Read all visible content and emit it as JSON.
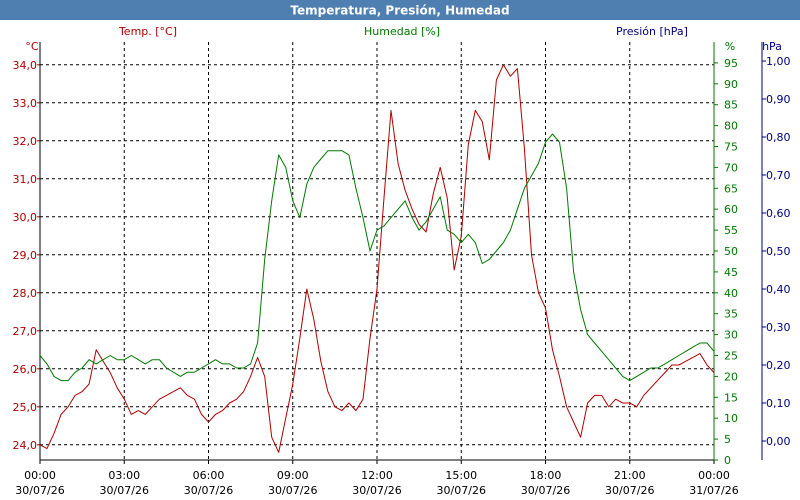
{
  "chart_data": {
    "type": "line",
    "title": "Temperatura, Presión, Humedad",
    "colors": {
      "title_bar": "#4f7fb0",
      "title_text": "#ffffff",
      "temp": "#b00000",
      "humidity": "#007a00",
      "pressure": "#000080",
      "grid": "#000000"
    },
    "grid": true,
    "x_ticks": [
      {
        "time": "00:00",
        "date": "30/07/26"
      },
      {
        "time": "03:00",
        "date": "30/07/26"
      },
      {
        "time": "06:00",
        "date": "30/07/26"
      },
      {
        "time": "09:00",
        "date": "30/07/26"
      },
      {
        "time": "12:00",
        "date": "30/07/26"
      },
      {
        "time": "15:00",
        "date": "30/07/26"
      },
      {
        "time": "18:00",
        "date": "30/07/26"
      },
      {
        "time": "21:00",
        "date": "30/07/26"
      },
      {
        "time": "00:00",
        "date": "31/07/26"
      }
    ],
    "axes": {
      "temp": {
        "label": "Temp. [°C]",
        "unit": "°C",
        "min": 23.6,
        "max": 34.6,
        "ticks": [
          "24,0",
          "25,0",
          "26,0",
          "27,0",
          "28,0",
          "29,0",
          "30,0",
          "31,0",
          "32,0",
          "33,0",
          "34,0"
        ],
        "tick_values": [
          24,
          25,
          26,
          27,
          28,
          29,
          30,
          31,
          32,
          33,
          34
        ]
      },
      "humidity": {
        "label": "Humedad [%]",
        "unit": "%",
        "min": 0,
        "max": 100,
        "ticks": [
          "0",
          "5",
          "10",
          "15",
          "20",
          "25",
          "30",
          "35",
          "40",
          "45",
          "50",
          "55",
          "60",
          "65",
          "70",
          "75",
          "80",
          "85",
          "90",
          "95"
        ],
        "tick_values": [
          0,
          5,
          10,
          15,
          20,
          25,
          30,
          35,
          40,
          45,
          50,
          55,
          60,
          65,
          70,
          75,
          80,
          85,
          90,
          95
        ]
      },
      "pressure": {
        "label": "Presión [hPa]",
        "unit": "hPa",
        "min": -0.05,
        "max": 1.05,
        "ticks": [
          "0,00",
          "0,10",
          "0,20",
          "0,30",
          "0,40",
          "0,50",
          "0,60",
          "0,70",
          "0,80",
          "0,90",
          "1,00"
        ],
        "tick_values": [
          0,
          0.1,
          0.2,
          0.3,
          0.4,
          0.5,
          0.6,
          0.7,
          0.8,
          0.9,
          1.0
        ]
      }
    },
    "series": [
      {
        "name": "Temp. [°C]",
        "axis": "temp",
        "x_hours": [
          0,
          0.25,
          0.5,
          0.75,
          1,
          1.25,
          1.5,
          1.75,
          2,
          2.25,
          2.5,
          2.75,
          3,
          3.25,
          3.5,
          3.75,
          4,
          4.25,
          4.5,
          4.75,
          5,
          5.25,
          5.5,
          5.75,
          6,
          6.25,
          6.5,
          6.75,
          7,
          7.25,
          7.5,
          7.75,
          8,
          8.25,
          8.5,
          8.75,
          9,
          9.25,
          9.5,
          9.75,
          10,
          10.25,
          10.5,
          10.75,
          11,
          11.25,
          11.5,
          11.75,
          12,
          12.25,
          12.5,
          12.75,
          13,
          13.25,
          13.5,
          13.75,
          14,
          14.25,
          14.5,
          14.75,
          15,
          15.25,
          15.5,
          15.75,
          16,
          16.25,
          16.5,
          16.75,
          17,
          17.25,
          17.5,
          17.75,
          18,
          18.25,
          18.5,
          18.75,
          19,
          19.25,
          19.5,
          19.75,
          20,
          20.25,
          20.5,
          20.75,
          21,
          21.25,
          21.5,
          21.75,
          22,
          22.25,
          22.5,
          22.75,
          23,
          23.25,
          23.5,
          23.75,
          24
        ],
        "values": [
          24.0,
          23.9,
          24.3,
          24.8,
          25.0,
          25.3,
          25.4,
          25.6,
          26.5,
          26.2,
          25.9,
          25.5,
          25.2,
          24.8,
          24.9,
          24.8,
          25.0,
          25.2,
          25.3,
          25.4,
          25.5,
          25.3,
          25.2,
          24.8,
          24.6,
          24.8,
          24.9,
          25.1,
          25.2,
          25.4,
          25.8,
          26.3,
          25.8,
          24.2,
          23.8,
          24.7,
          25.6,
          26.8,
          28.1,
          27.3,
          26.2,
          25.4,
          25.0,
          24.9,
          25.1,
          24.9,
          25.2,
          26.8,
          28.1,
          30.5,
          32.8,
          31.4,
          30.7,
          30.2,
          29.8,
          29.6,
          30.6,
          31.3,
          30.5,
          28.6,
          29.5,
          31.9,
          32.8,
          32.5,
          31.5,
          33.6,
          34.0,
          33.7,
          33.9,
          31.8,
          29.0,
          28.0,
          27.6,
          26.5,
          25.8,
          25.0,
          24.6,
          24.2,
          25.1,
          25.3,
          25.3,
          25.0,
          25.2,
          25.1,
          25.1,
          25.0,
          25.3,
          25.5,
          25.7,
          25.9,
          26.1,
          26.1,
          26.2,
          26.3,
          26.4,
          26.1,
          25.9
        ]
      },
      {
        "name": "Humedad [%]",
        "axis": "humidity",
        "x_hours": [
          0,
          0.25,
          0.5,
          0.75,
          1,
          1.25,
          1.5,
          1.75,
          2,
          2.25,
          2.5,
          2.75,
          3,
          3.25,
          3.5,
          3.75,
          4,
          4.25,
          4.5,
          4.75,
          5,
          5.25,
          5.5,
          5.75,
          6,
          6.25,
          6.5,
          6.75,
          7,
          7.25,
          7.5,
          7.75,
          8,
          8.25,
          8.5,
          8.75,
          9,
          9.25,
          9.5,
          9.75,
          10,
          10.25,
          10.5,
          10.75,
          11,
          11.25,
          11.5,
          11.75,
          12,
          12.25,
          12.5,
          12.75,
          13,
          13.25,
          13.5,
          13.75,
          14,
          14.25,
          14.5,
          14.75,
          15,
          15.25,
          15.5,
          15.75,
          16,
          16.25,
          16.5,
          16.75,
          17,
          17.25,
          17.5,
          17.75,
          18,
          18.25,
          18.5,
          18.75,
          19,
          19.25,
          19.5,
          19.75,
          20,
          20.25,
          20.5,
          20.75,
          21,
          21.25,
          21.5,
          21.75,
          22,
          22.25,
          22.5,
          22.75,
          23,
          23.25,
          23.5,
          23.75,
          24
        ],
        "values": [
          25,
          23,
          20,
          19,
          19,
          21,
          22,
          24,
          23,
          24,
          25,
          24,
          24,
          25,
          24,
          23,
          24,
          24,
          22,
          21,
          20,
          21,
          21,
          22,
          23,
          24,
          23,
          23,
          22,
          22,
          23,
          28,
          48,
          62,
          73,
          70,
          62,
          58,
          66,
          70,
          72,
          74,
          74,
          74,
          73,
          65,
          58,
          50,
          55,
          56,
          58,
          60,
          62,
          58,
          55,
          57,
          60,
          63,
          55,
          54,
          52,
          54,
          52,
          47,
          48,
          50,
          52,
          55,
          60,
          65,
          68,
          71,
          76,
          78,
          76,
          65,
          45,
          36,
          30,
          28,
          26,
          24,
          22,
          20,
          19,
          20,
          21,
          22,
          22,
          23,
          24,
          25,
          26,
          27,
          28,
          28,
          26
        ]
      }
    ]
  }
}
